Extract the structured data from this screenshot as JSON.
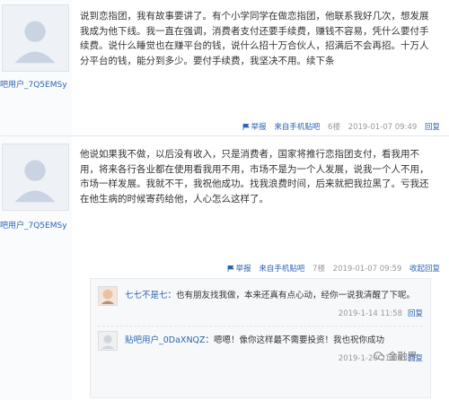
{
  "posts": [
    {
      "username": "吧用户_7Q5EMSy",
      "content": "说到恋指团，我有故事要讲了。有个小学同学在做恋指团，他联系我好几次，想发展我成为他下线。我一直在强调，消费者支付还要手续费，赚钱不容易，凭什么要付手续费。说什么睡觉也在赚平台的钱，说什么招十万合伙人，招满后不会再招。十万人分平台的钱，能分到多少。要付手续费，我坚决不用。续下条",
      "report": "举报",
      "source": "来自手机贴吧",
      "floor": "6楼",
      "time": "2019-01-07 09:49",
      "reply_label": "回复"
    },
    {
      "username": "吧用户_7Q5EMSy",
      "content": "他说如果我不做，以后没有收入，只是消费者，国家将推行恋指团支付，看我用不用，将来各行各业都在使用看我用不用，市场不是为一个人发展，说我一个人不用，市场一样发展。我就不干，我祝他成功。找我浪费时间，后来就把我拉黑了。亏我还在他生病的时候寄药给他，人心怎么这样了。",
      "report": "举报",
      "source": "来自手机贴吧",
      "floor": "7楼",
      "time": "2019-01-07 09:59",
      "reply_label": "收起回复"
    }
  ],
  "replies": [
    {
      "user": "七七不是七",
      "text": "：也有朋友找我做，本来还真有点心动，经你一说我清醒了下呢。",
      "time": "2019-1-14 11:58",
      "reply_label": "回复"
    },
    {
      "user": "贴吧用户_0DaXNQZ",
      "text": "：嗯嗯！像你这样最不需要投资！我也祝你成功",
      "time": "2019-1-20 21:06",
      "reply_label": "回复"
    }
  ],
  "watermark": "金融界"
}
